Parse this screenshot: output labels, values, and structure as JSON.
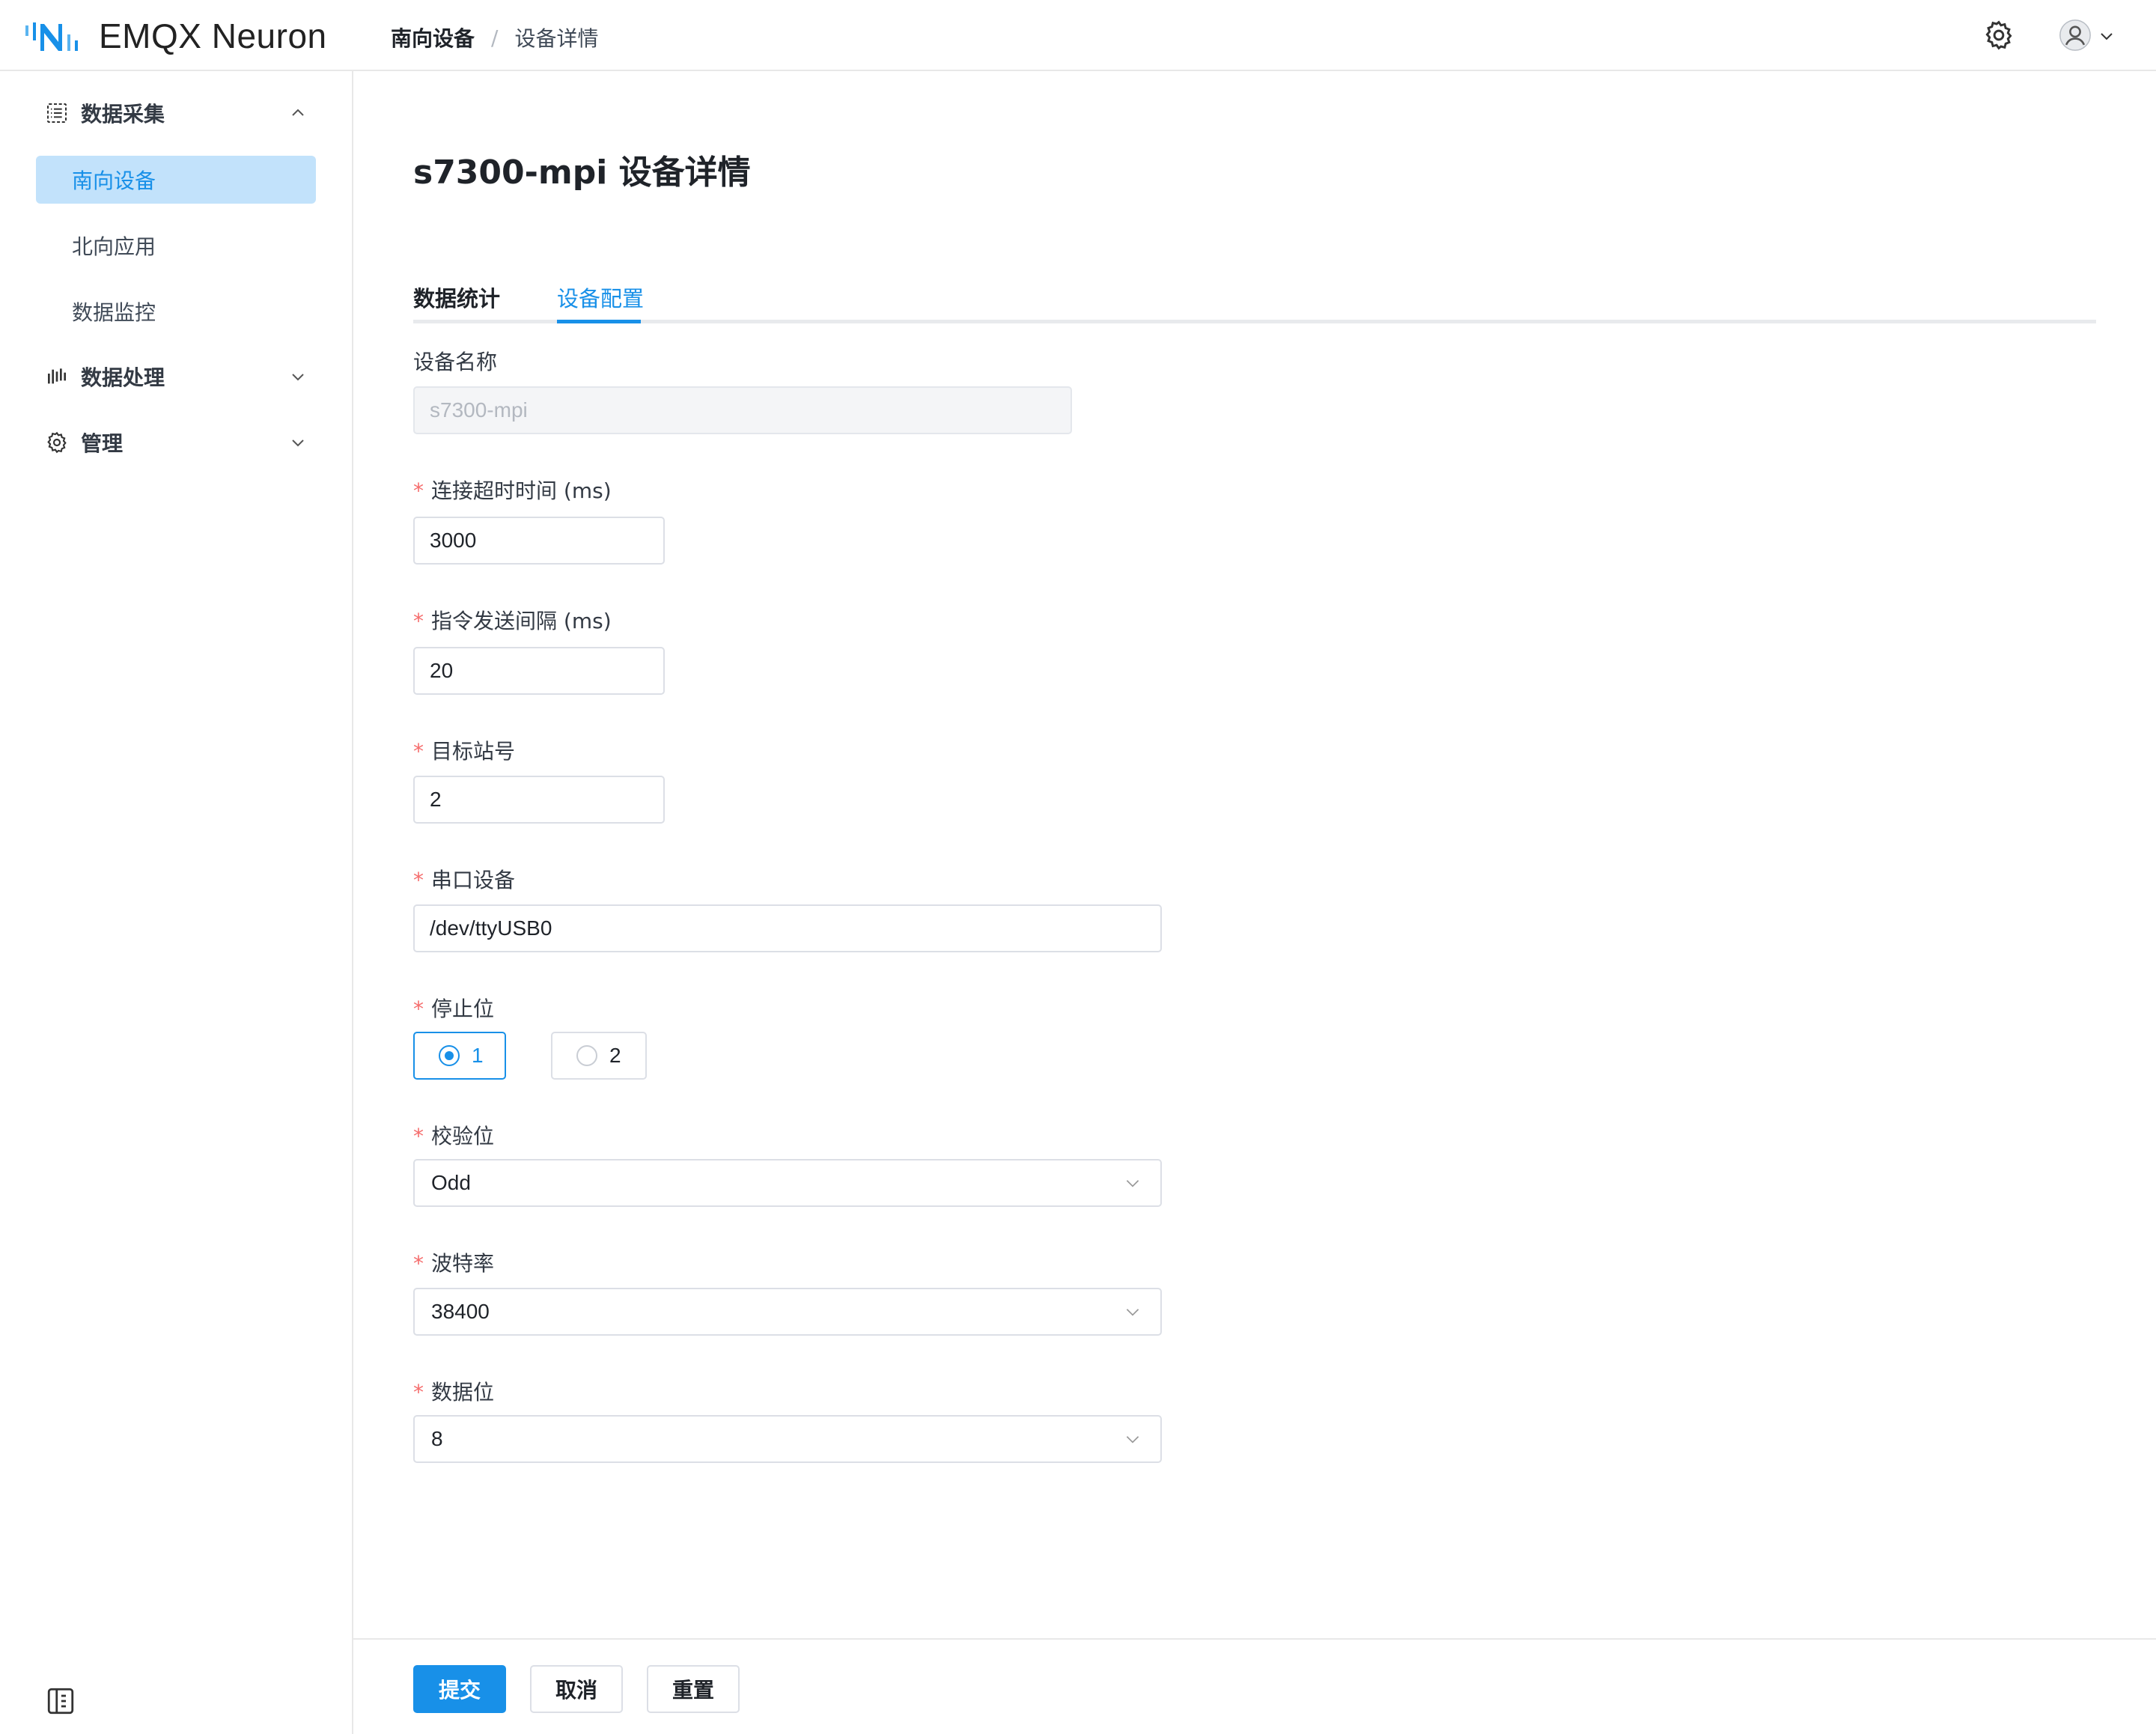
{
  "app": {
    "title": "EMQX Neuron"
  },
  "breadcrumb": {
    "parent": "南向设备",
    "separator": "/",
    "current": "设备详情"
  },
  "sidebar": {
    "groups": [
      {
        "label": "数据采集",
        "expanded": true,
        "icon": "list-icon"
      },
      {
        "label": "数据处理",
        "expanded": false,
        "icon": "bars-icon"
      },
      {
        "label": "管理",
        "expanded": false,
        "icon": "gear-icon"
      }
    ],
    "items": [
      {
        "label": "南向设备",
        "active": true
      },
      {
        "label": "北向应用",
        "active": false
      },
      {
        "label": "数据监控",
        "active": false
      }
    ]
  },
  "page": {
    "title": "s7300-mpi 设备详情"
  },
  "tabs": [
    {
      "label": "数据统计",
      "active": false
    },
    {
      "label": "设备配置",
      "active": true
    }
  ],
  "form": {
    "device_name": {
      "label": "设备名称",
      "value": "s7300-mpi",
      "disabled": true
    },
    "connect_timeout": {
      "label": "连接超时时间 (ms)",
      "required": true,
      "value": "3000"
    },
    "send_interval": {
      "label": "指令发送间隔 (ms)",
      "required": true,
      "value": "20"
    },
    "target_station": {
      "label": "目标站号",
      "required": true,
      "value": "2"
    },
    "serial_device": {
      "label": "串口设备",
      "required": true,
      "value": "/dev/ttyUSB0"
    },
    "stop_bits": {
      "label": "停止位",
      "required": true,
      "options": [
        "1",
        "2"
      ],
      "selected": "1"
    },
    "parity": {
      "label": "校验位",
      "required": true,
      "value": "Odd"
    },
    "baud_rate": {
      "label": "波特率",
      "required": true,
      "value": "38400"
    },
    "data_bits": {
      "label": "数据位",
      "required": true,
      "value": "8"
    },
    "required_mark": "*"
  },
  "footer": {
    "submit": "提交",
    "cancel": "取消",
    "reset": "重置"
  },
  "colors": {
    "primary": "#1890e8",
    "active_bg": "#c2e2fb",
    "required": "#f56c6c"
  }
}
